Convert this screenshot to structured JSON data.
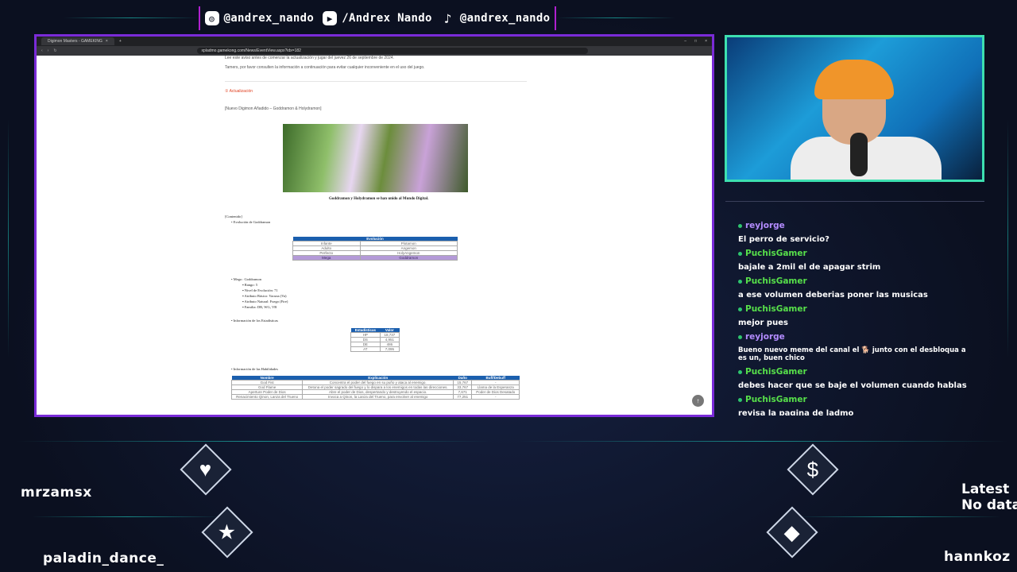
{
  "social": {
    "instagram": "@andrex_nando",
    "youtube": "/Andrex Nando",
    "tiktok": "@andrex_nando"
  },
  "browser": {
    "tab_title": "Digimon Masters - GAMEKING",
    "url": "xpladmo.gamekong.com/News/EventView.aspx?idx=182"
  },
  "page": {
    "line1": "Lee este aviso antes de comenzar la actualización y jugar del juevez 26 de septiembre de 2024.",
    "line2": "Tamers, por favor consulten la información a continuación para evitar cualquier inconveniente en el uso del juego.",
    "section": "① Actualización",
    "subtitle": "[Nuevo Digimon Añadido – Goddramon & Holydramon]",
    "caption": "Goddramon y Holydramon se han unido al Mundo Digital.",
    "contenido": "[Contenido]",
    "evo_item": "Evolución de Goddramon",
    "evo_table": {
      "header": "Evolución",
      "rows": [
        [
          "Infante",
          "Plotamon"
        ],
        [
          "Adulto",
          "Angemon"
        ],
        [
          "Perfecto",
          "HolyAngemon"
        ],
        [
          "Mega",
          "Goddramon"
        ]
      ]
    },
    "mega": {
      "title": "Mega : Goddramon",
      "items": [
        "Rango: 5",
        "Nivel de Evolución: 71",
        "Atributo Básico: Vacuna (Va)",
        "Atributo Natural: Fuego (Fire)",
        "Familia: DR, WG, VB"
      ]
    },
    "stats_item": "Información de los Estadísticas",
    "stats_table": {
      "headers": [
        "Estadísticas",
        "Valor"
      ],
      "rows": [
        [
          "HP",
          "18,737"
        ],
        [
          "DS",
          "4,951"
        ],
        [
          "DE",
          "486"
        ],
        [
          "AT",
          "7,095"
        ]
      ]
    },
    "skills_item": "Información de las Habilidades",
    "skills_table": {
      "headers": [
        "Nombre",
        "Explicación",
        "Daño",
        "Buff/Debuff"
      ],
      "rows": [
        [
          "God Fist",
          "Concentra el poder del fuego en su puño y ataca al enemigo.",
          "15,767",
          "-"
        ],
        [
          "God Flame",
          "Detona el poder sagrado del fuego y lo dispara a los enemigos en todas las direcciones.",
          "33,767",
          "Llama de la Esperanza"
        ],
        [
          "Aperture Poder de Dios",
          "Abre el poder de Dios, despertando y destruyendo el espacio.",
          "7,671",
          "Poder de Dios Desatado"
        ],
        [
          "Renacimiento Qinon, Lanza del Trueno",
          "Invoca a Qinon, la Lanza del Trueno, para envolver al enemigo",
          "77,251",
          "-"
        ]
      ]
    }
  },
  "chat": [
    {
      "user": "reyjorge",
      "color": "#b48cff",
      "text": "El perro de servicio?"
    },
    {
      "user": "PuchisGamer",
      "color": "#57e04a",
      "text": "bajale a 2mil el de apagar strim"
    },
    {
      "user": "PuchisGamer",
      "color": "#57e04a",
      "text": "a ese volumen deberias poner las musicas"
    },
    {
      "user": "PuchisGamer",
      "color": "#57e04a",
      "text": "mejor pues"
    },
    {
      "user": "reyjorge",
      "color": "#b48cff",
      "text": "Bueno nuevo meme del canal el 🐕 junto con el desbloqua a es un, buen chico"
    },
    {
      "user": "PuchisGamer",
      "color": "#57e04a",
      "text": "debes hacer que se baje el volumen cuando hablas"
    },
    {
      "user": "PuchisGamer",
      "color": "#57e04a",
      "text": "revisa la pagina de ladmo"
    }
  ],
  "alerts": {
    "follower1": "mrzamsx",
    "follower2": "paladin_dance_",
    "latest_line1": "Latest",
    "latest_line2": "No data",
    "donor": "hannkoz"
  },
  "icons": {
    "heart": "heart-icon",
    "star": "star-icon",
    "dollar": "dollar-icon",
    "diamond": "diamond-icon"
  },
  "colors": {
    "accent_purple": "#7a2bd8",
    "accent_teal": "#3de0b0"
  }
}
